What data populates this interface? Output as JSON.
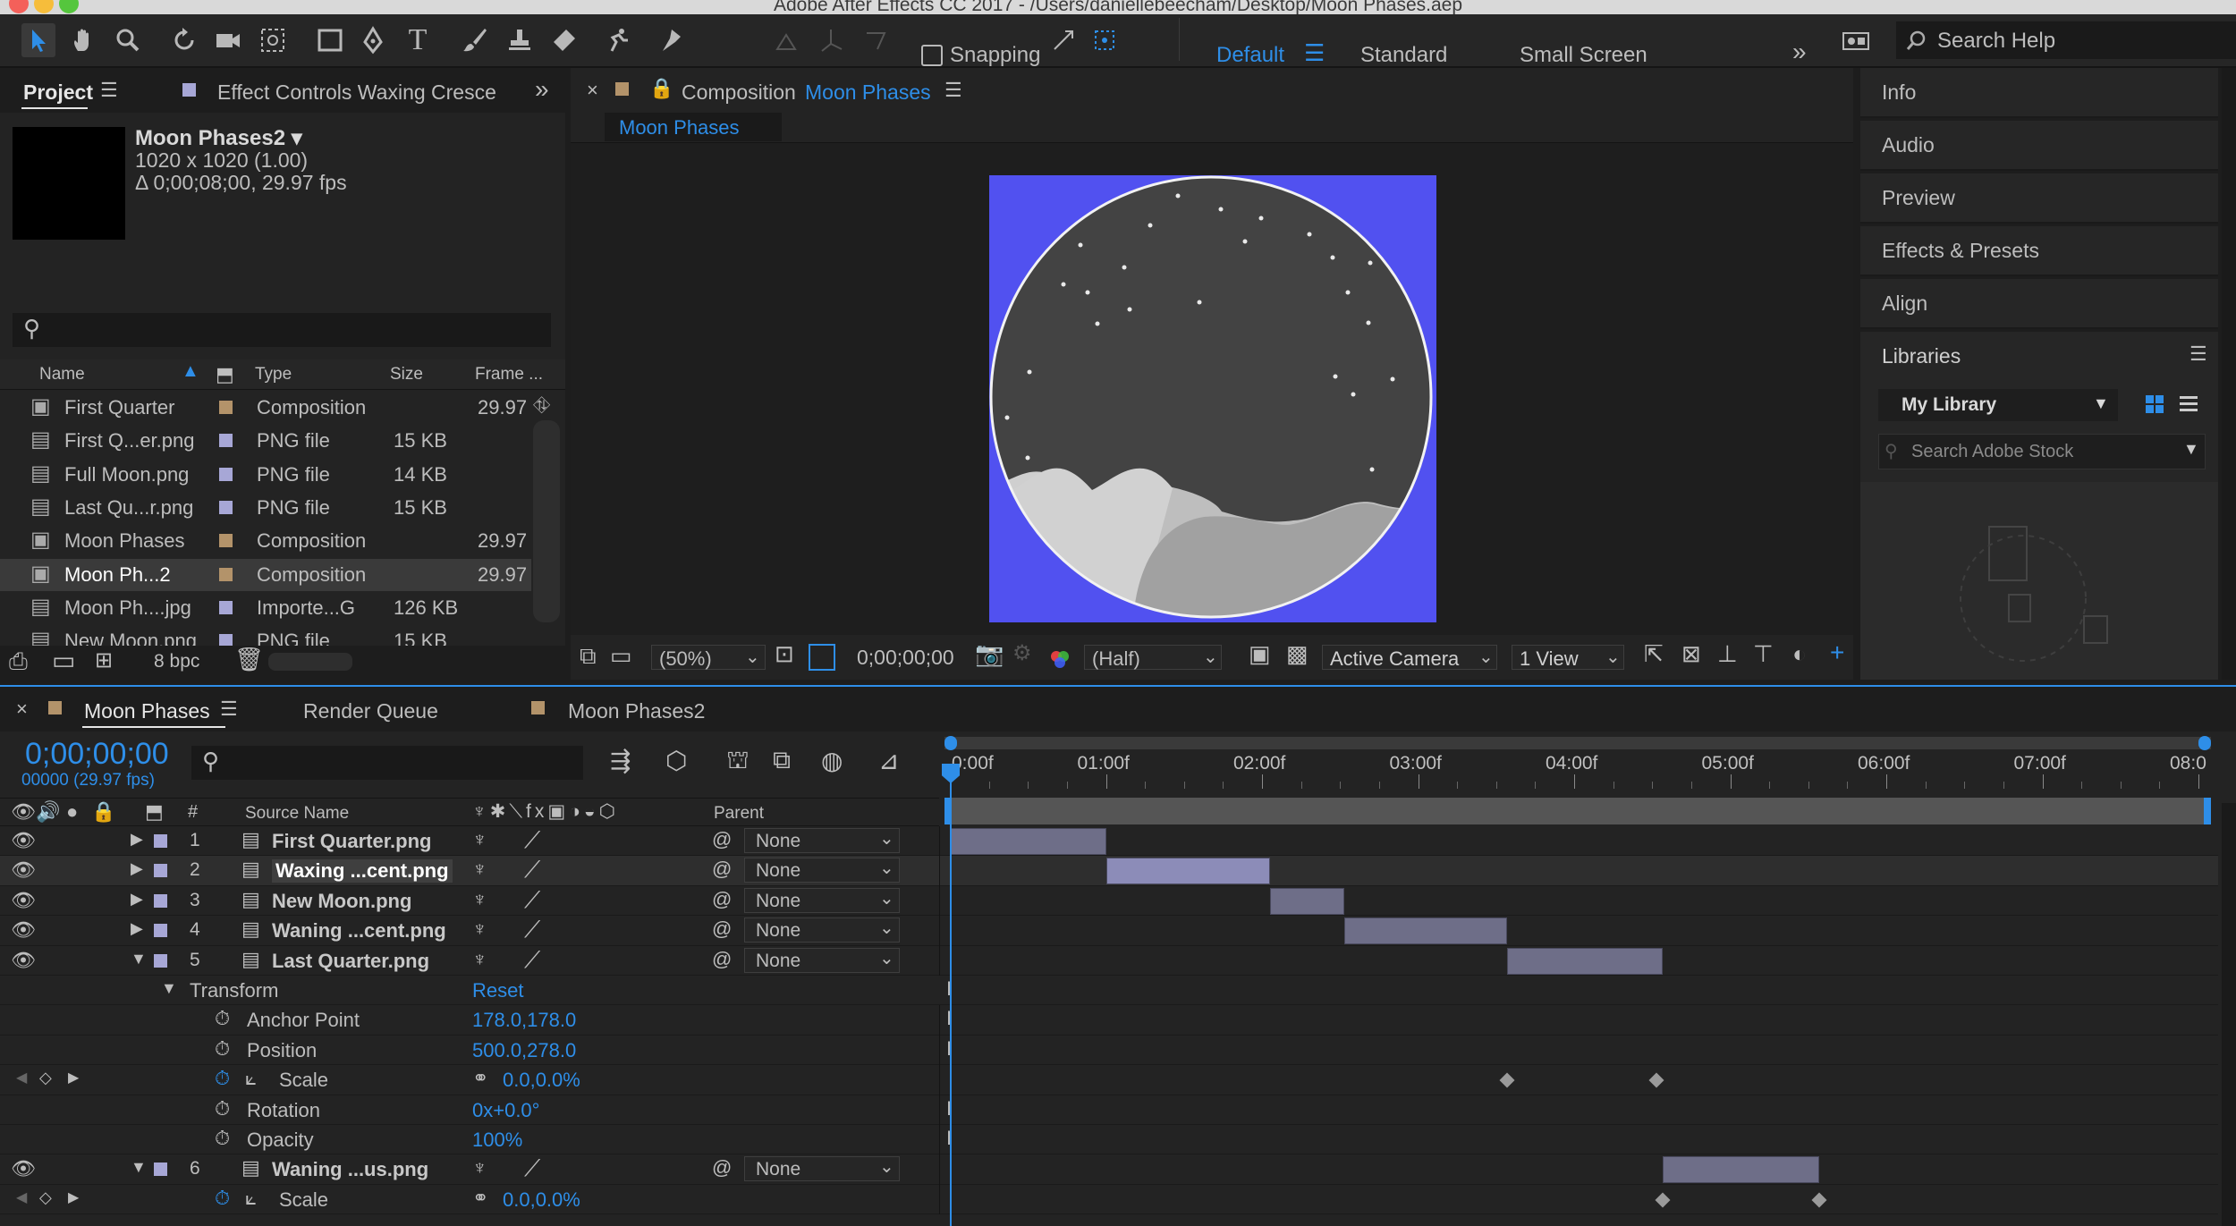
{
  "app": {
    "title": "Adobe After Effects CC 2017 - /Users/daniellebeecham/Desktop/Moon Phases.aep"
  },
  "toolbar": {
    "snapping_label": "Snapping",
    "workspaces": [
      "Default",
      "Standard",
      "Small Screen"
    ],
    "search_placeholder": "Search Help"
  },
  "project": {
    "tab_label": "Project",
    "effect_controls_label": "Effect Controls Waxing Cresce",
    "preview_name": "Moon Phases2 ▾",
    "preview_dims": "1020 x 1020 (1.00)",
    "preview_duration": "Δ 0;00;08;00, 29.97 fps",
    "columns": [
      "Name",
      "Type",
      "Size",
      "Frame ..."
    ],
    "items": [
      {
        "name": "First Quarter",
        "type": "Composition",
        "size": "",
        "frame": "29.97",
        "icon": "composition-icon",
        "color": "#b3936a"
      },
      {
        "name": "First Q...er.png",
        "type": "PNG file",
        "size": "15 KB",
        "frame": "",
        "icon": "file-icon",
        "color": "#a7a7d6"
      },
      {
        "name": "Full Moon.png",
        "type": "PNG file",
        "size": "14 KB",
        "frame": "",
        "icon": "file-icon",
        "color": "#a7a7d6"
      },
      {
        "name": "Last Qu...r.png",
        "type": "PNG file",
        "size": "15 KB",
        "frame": "",
        "icon": "file-icon",
        "color": "#a7a7d6"
      },
      {
        "name": "Moon Phases",
        "type": "Composition",
        "size": "",
        "frame": "29.97",
        "icon": "composition-icon",
        "color": "#b3936a"
      },
      {
        "name": "Moon Ph...2",
        "type": "Composition",
        "size": "",
        "frame": "29.97",
        "icon": "composition-icon",
        "color": "#b3936a"
      },
      {
        "name": "Moon Ph....jpg",
        "type": "Importe...G",
        "size": "126 KB",
        "frame": "",
        "icon": "file-icon",
        "color": "#a7a7d6"
      },
      {
        "name": "New Moon.png",
        "type": "PNG file",
        "size": "15 KB",
        "frame": "",
        "icon": "file-icon",
        "color": "#a7a7d6"
      }
    ],
    "bpc_label": "8 bpc"
  },
  "composition": {
    "tab_prefix": "Composition",
    "tab_name": "Moon Phases",
    "flow_tab": "Moon Phases",
    "zoom": "(50%)",
    "timecode": "0;00;00;00",
    "resolution": "(Half)",
    "camera": "Active Camera",
    "views": "1 View"
  },
  "right_panels": {
    "items": [
      "Info",
      "Audio",
      "Preview",
      "Effects & Presets",
      "Align",
      "Libraries"
    ],
    "library_name": "My Library",
    "stock_placeholder": "Search Adobe Stock"
  },
  "timeline": {
    "tabs": [
      "Moon Phases",
      "Render Queue",
      "Moon Phases2"
    ],
    "timecode": "0;00;00;00",
    "fps_label": "00000 (29.97 fps)",
    "columns": {
      "source": "Source Name",
      "parent": "Parent"
    },
    "ruler": [
      "0:00f",
      "01:00f",
      "02:00f",
      "03:00f",
      "04:00f",
      "05:00f",
      "06:00f",
      "07:00f",
      "08:0"
    ],
    "layers": [
      {
        "num": "1",
        "name": "First Quarter.png",
        "parent": "None",
        "in": 0.0,
        "out": 1.0
      },
      {
        "num": "2",
        "name": "Waxing ...cent.png",
        "parent": "None",
        "in": 1.0,
        "out": 2.05
      },
      {
        "num": "3",
        "name": "New Moon.png",
        "parent": "None",
        "in": 2.05,
        "out": 2.53
      },
      {
        "num": "4",
        "name": "Waning ...cent.png",
        "parent": "None",
        "in": 2.53,
        "out": 3.57
      },
      {
        "num": "5",
        "name": "Last Quarter.png",
        "parent": "None",
        "in": 3.57,
        "out": 4.57
      }
    ],
    "transform": {
      "label": "Transform",
      "reset": "Reset",
      "props": [
        {
          "name": "Anchor Point",
          "value": "178.0,178.0"
        },
        {
          "name": "Position",
          "value": "500.0,278.0"
        },
        {
          "name": "Scale",
          "value": "0.0,0.0%"
        },
        {
          "name": "Rotation",
          "value": "0x+0.0°"
        },
        {
          "name": "Opacity",
          "value": "100%"
        }
      ]
    },
    "layer6": {
      "num": "6",
      "name": "Waning ...us.png",
      "parent": "None",
      "in": 4.57,
      "out": 5.57
    },
    "layer6_scale": {
      "name": "Scale",
      "value": "0.0,0.0%"
    },
    "keyframes_layer5": [
      3.57,
      4.53
    ],
    "keyframes_layer6": [
      4.57,
      5.57
    ]
  }
}
